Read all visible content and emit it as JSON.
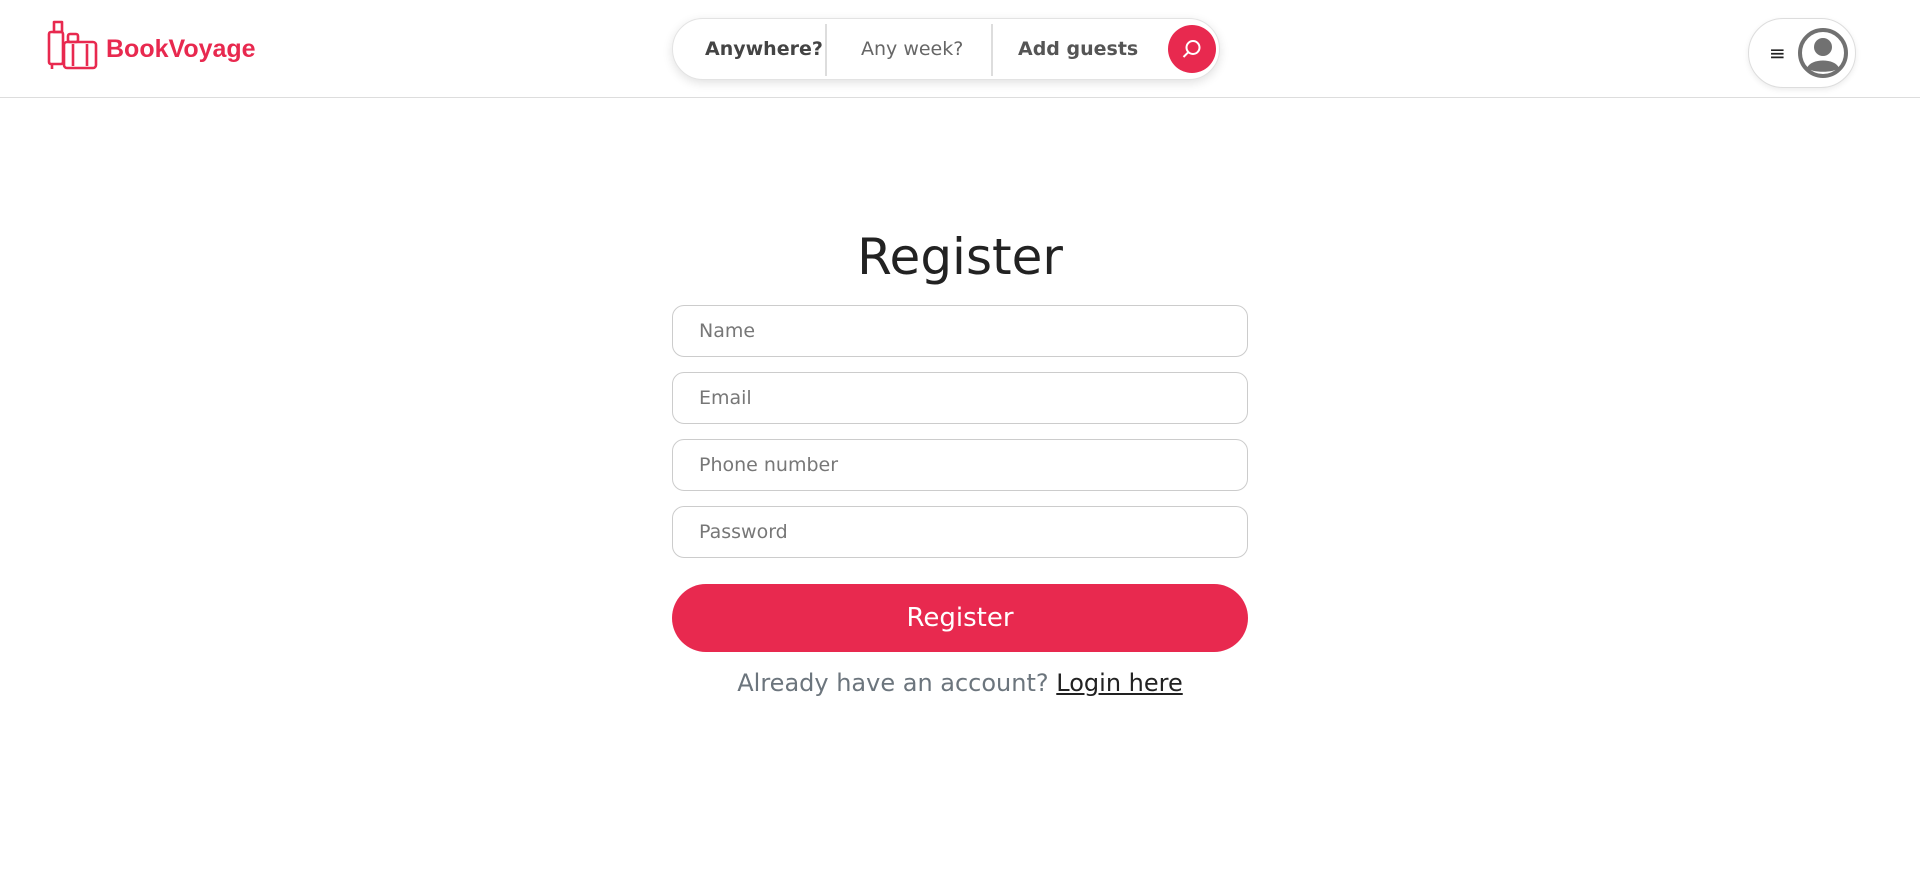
{
  "brand": {
    "name": "BookVoyage",
    "color": "#e8294f"
  },
  "search": {
    "where": "Anywhere?",
    "when": "Any week?",
    "guests": "Add guests",
    "button_icon": "search-icon"
  },
  "user_menu": {
    "menu_icon": "≡",
    "avatar_icon": "user-circle-icon"
  },
  "form": {
    "title": "Register",
    "name_placeholder": "Name",
    "email_placeholder": "Email",
    "phone_placeholder": "Phone number",
    "password_placeholder": "Password",
    "submit_label": "Register",
    "login_prompt": "Already have an account?",
    "login_link": "Login here"
  },
  "colors": {
    "accent": "#e8294f",
    "muted_text": "#6c757d"
  }
}
